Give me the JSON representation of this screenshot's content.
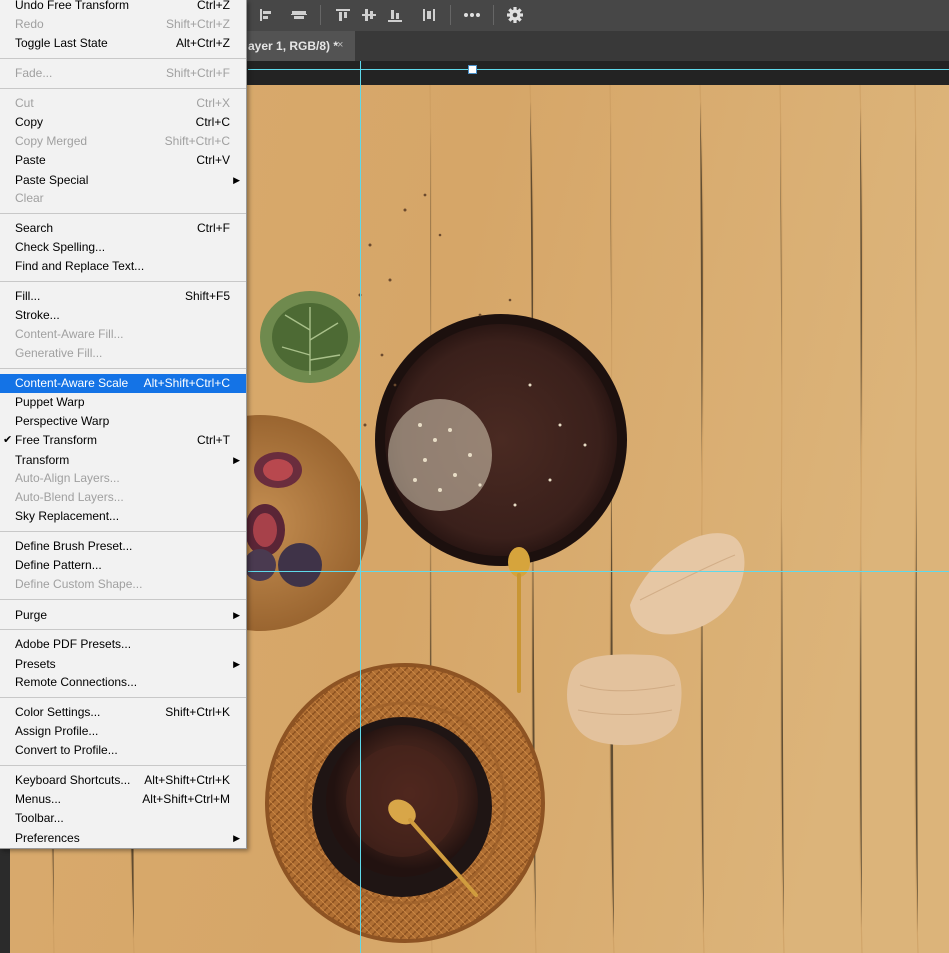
{
  "document_tab": {
    "title": "ayer 1, RGB/8) *",
    "close_glyph": "×"
  },
  "toolbar_icons": [
    "align-left-edges-icon",
    "align-horizontal-centers-icon",
    "align-top-edges-icon",
    "align-vertical-centers-icon",
    "align-bottom-edges-icon",
    "distribute-icon",
    "more-options-icon",
    "gear-icon"
  ],
  "menu": {
    "items": [
      {
        "label": "Undo Free Transform",
        "shortcut": "Ctrl+Z",
        "disabled": false
      },
      {
        "label": "Redo",
        "shortcut": "Shift+Ctrl+Z",
        "disabled": true
      },
      {
        "label": "Toggle Last State",
        "shortcut": "Alt+Ctrl+Z",
        "disabled": false
      },
      {
        "label": "Fade...",
        "shortcut": "Shift+Ctrl+F",
        "disabled": true
      },
      {
        "label": "Cut",
        "shortcut": "Ctrl+X",
        "disabled": true
      },
      {
        "label": "Copy",
        "shortcut": "Ctrl+C",
        "disabled": false
      },
      {
        "label": "Copy Merged",
        "shortcut": "Shift+Ctrl+C",
        "disabled": true
      },
      {
        "label": "Paste",
        "shortcut": "Ctrl+V",
        "disabled": false
      },
      {
        "label": "Paste Special",
        "shortcut": "",
        "submenu": true,
        "disabled": false
      },
      {
        "label": "Clear",
        "shortcut": "",
        "disabled": true
      },
      {
        "label": "Search",
        "shortcut": "Ctrl+F",
        "disabled": false
      },
      {
        "label": "Check Spelling...",
        "shortcut": "",
        "disabled": false
      },
      {
        "label": "Find and Replace Text...",
        "shortcut": "",
        "disabled": false
      },
      {
        "label": "Fill...",
        "shortcut": "Shift+F5",
        "disabled": false
      },
      {
        "label": "Stroke...",
        "shortcut": "",
        "disabled": false
      },
      {
        "label": "Content-Aware Fill...",
        "shortcut": "",
        "disabled": true
      },
      {
        "label": "Generative Fill...",
        "shortcut": "",
        "disabled": true
      },
      {
        "label": "Content-Aware Scale",
        "shortcut": "Alt+Shift+Ctrl+C",
        "disabled": false,
        "highlighted": true
      },
      {
        "label": "Puppet Warp",
        "shortcut": "",
        "disabled": false
      },
      {
        "label": "Perspective Warp",
        "shortcut": "",
        "disabled": false
      },
      {
        "label": "Free Transform",
        "shortcut": "Ctrl+T",
        "disabled": false,
        "checked": true
      },
      {
        "label": "Transform",
        "shortcut": "",
        "submenu": true,
        "disabled": false
      },
      {
        "label": "Auto-Align Layers...",
        "shortcut": "",
        "disabled": true
      },
      {
        "label": "Auto-Blend Layers...",
        "shortcut": "",
        "disabled": true
      },
      {
        "label": "Sky Replacement...",
        "shortcut": "",
        "disabled": false
      },
      {
        "label": "Define Brush Preset...",
        "shortcut": "",
        "disabled": false
      },
      {
        "label": "Define Pattern...",
        "shortcut": "",
        "disabled": false
      },
      {
        "label": "Define Custom Shape...",
        "shortcut": "",
        "disabled": true
      },
      {
        "label": "Purge",
        "shortcut": "",
        "submenu": true,
        "disabled": false
      },
      {
        "label": "Adobe PDF Presets...",
        "shortcut": "",
        "disabled": false
      },
      {
        "label": "Presets",
        "shortcut": "",
        "submenu": true,
        "disabled": false
      },
      {
        "label": "Remote Connections...",
        "shortcut": "",
        "disabled": false
      },
      {
        "label": "Color Settings...",
        "shortcut": "Shift+Ctrl+K",
        "disabled": false
      },
      {
        "label": "Assign Profile...",
        "shortcut": "",
        "disabled": false
      },
      {
        "label": "Convert to Profile...",
        "shortcut": "",
        "disabled": false
      },
      {
        "label": "Keyboard Shortcuts...",
        "shortcut": "Alt+Shift+Ctrl+K",
        "disabled": false
      },
      {
        "label": "Menus...",
        "shortcut": "Alt+Shift+Ctrl+M",
        "disabled": false
      },
      {
        "label": "Toolbar...",
        "shortcut": "",
        "disabled": false
      },
      {
        "label": "Preferences",
        "shortcut": "",
        "submenu": true,
        "disabled": false
      }
    ],
    "check_glyph": "✔",
    "submenu_glyph": "▶"
  },
  "colors": {
    "highlight": "#1473e6",
    "guide": "#5fd9ea",
    "wood": "#d2a56a"
  }
}
